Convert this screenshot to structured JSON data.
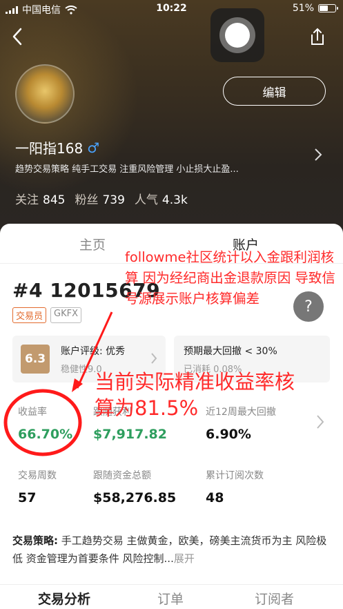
{
  "status_bar": {
    "carrier": "中国电信",
    "time": "10:22",
    "battery": "51%"
  },
  "profile": {
    "edit_label": "编辑",
    "name": "一阳指168",
    "gender_symbol": "♂",
    "bio": "趋势交易策略 纯手工交易 注重风险管理 小止损大止盈...",
    "stats": [
      {
        "label": "关注",
        "value": "845"
      },
      {
        "label": "粉丝",
        "value": "739"
      },
      {
        "label": "人气",
        "value": "4.3k"
      }
    ]
  },
  "tabs": {
    "home": "主页",
    "account": "账户"
  },
  "account": {
    "number": "#4 12015679",
    "tags": [
      "交易员",
      "GKFX"
    ],
    "rating_score": "6.3",
    "rating_title": "账户评级: 优秀",
    "rating_sub": "稳健性9.0",
    "dd_title": "预期最大回撤 < 30%",
    "dd_sub": "已消耗 0.08%",
    "metrics": [
      {
        "label": "收益率",
        "value": "66.70%"
      },
      {
        "label": "跟随获利",
        "value": "$7,917.82"
      },
      {
        "label": "近12周最大回撤",
        "value": "6.90%"
      },
      {
        "label": "交易周数",
        "value": "57"
      },
      {
        "label": "跟随资金总额",
        "value": "$58,276.85"
      },
      {
        "label": "累计订阅次数",
        "value": "48"
      }
    ],
    "strategy_label": "交易策略:",
    "strategy_text": " 手工趋势交易 主做黄金，欧美，磅美主流货币为主 风险极低 资金管理为首要条件 风险控制...",
    "expand": "展开"
  },
  "bottom_tabs": [
    "交易分析",
    "订单",
    "订阅者"
  ],
  "annotations": {
    "note1": "followme社区统计以入金跟利润核算 因为经纪商出金退款原因 导致信号源展示账户核算偏差",
    "note2": "当前实际精准收益率核算为81.5%"
  }
}
